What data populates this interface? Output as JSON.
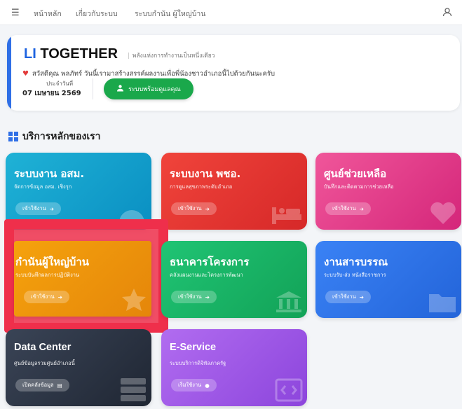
{
  "nav": {
    "links": [
      "หน้าหลัก",
      "เกี่ยวกับระบบ",
      "ระบบกำนัน ผู้ใหญ่บ้าน"
    ]
  },
  "hero": {
    "brand_prefix": "LI",
    "brand_rest": " TOGETHER",
    "tagline": "พลังแห่งการทำงานเป็นหนึ่งเดียว",
    "greeting": "สวัสดีคุณ พลภัทร์ วันนี้เรามาสร้างสรรค์ผลงานเพื่อพี่น้องชาวอำเภอนี้ไปด้วยกันนะครับ",
    "date_label": "ประจำวันที่",
    "date": "07 เมษายน 2569",
    "button": "ระบบพร้อมดูแลคุณ"
  },
  "section_title": "บริการหลักของเรา",
  "cards": [
    {
      "title": "ระบบงาน อสม.",
      "subtitle": "จัดการข้อมูล อสม. เชิงรุก",
      "action": "เข้าใช้งาน"
    },
    {
      "title": "ระบบงาน พชอ.",
      "subtitle": "การดูแลสุขภาพระดับอำเภอ",
      "action": "เข้าใช้งาน"
    },
    {
      "title": "ศูนย์ช่วยเหลือ",
      "subtitle": "บันทึกและติดตามการช่วยเหลือ",
      "action": "เข้าใช้งาน"
    },
    {
      "title": "กำนันผู้ใหญ่บ้าน",
      "subtitle": "ระบบบันทึกผลการปฏิบัติงาน",
      "action": "เข้าใช้งาน"
    },
    {
      "title": "ธนาคารโครงการ",
      "subtitle": "คลังแผนงานและโครงการพัฒนา",
      "action": "เข้าใช้งาน"
    },
    {
      "title": "งานสารบรรณ",
      "subtitle": "ระบบรับ-ส่ง หนังสือราชการ",
      "action": "เข้าใช้งาน"
    },
    {
      "title": "Data Center",
      "subtitle": "ศูนย์ข้อมูลรวมศูนย์อำเภอนี้",
      "action": "เปิดคลังข้อมูล"
    },
    {
      "title": "E-Service",
      "subtitle": "ระบบบริการดิจิทัลภาครัฐ",
      "action": "เริ่มใช้งาน"
    }
  ],
  "colors": {
    "accent": "#2f6fe6",
    "highlight": "#ef2f4b"
  }
}
